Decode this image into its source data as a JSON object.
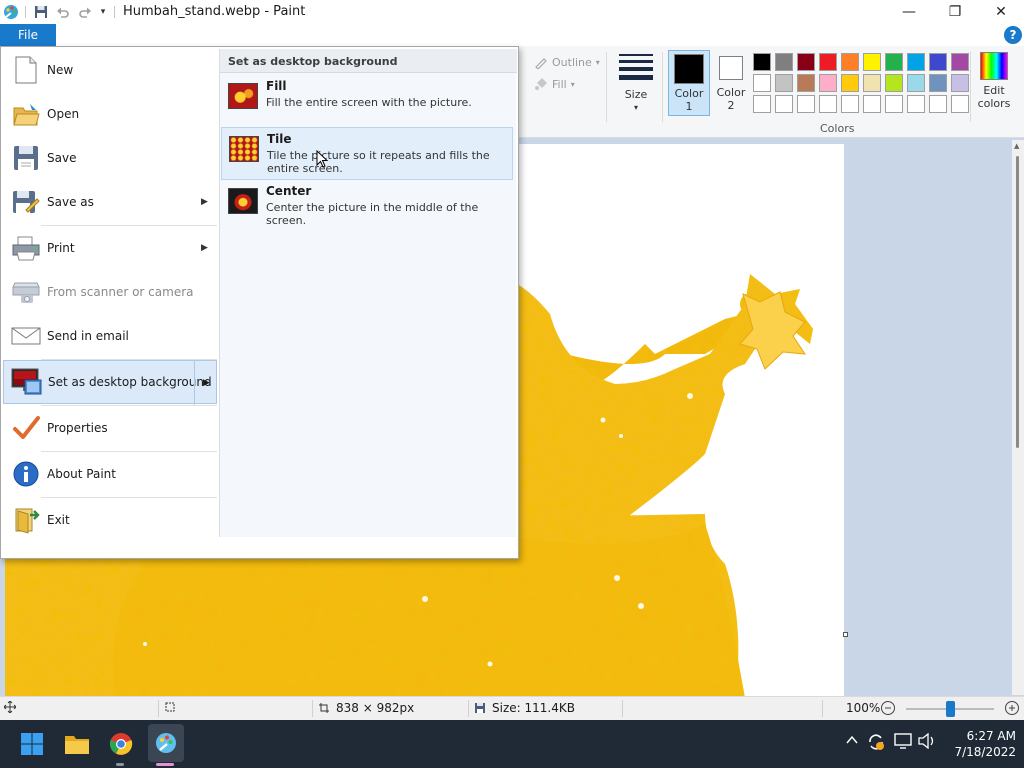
{
  "window": {
    "title": "Humbah_stand.webp - Paint",
    "quick_access_dropdown": "▾",
    "minimize": "—",
    "maximize": "❐",
    "close": "✕"
  },
  "ribbon": {
    "file_tab": "File",
    "help": "?",
    "outline_label": "Outline",
    "fill_label": "Fill",
    "size_label": "Size",
    "color1_label_a": "Color",
    "color1_label_b": "1",
    "color2_label_a": "Color",
    "color2_label_b": "2",
    "colors_group_label": "Colors",
    "edit_colors_a": "Edit",
    "edit_colors_b": "colors",
    "color1_value": "#000000",
    "color2_value": "#ffffff",
    "palette_row1": [
      "#000000",
      "#7f7f7f",
      "#880015",
      "#ed1c24",
      "#ff7f27",
      "#fff200",
      "#22b14c",
      "#00a2e8",
      "#3f48cc",
      "#a349a4"
    ],
    "palette_row2": [
      "#ffffff",
      "#c3c3c3",
      "#b97a57",
      "#ffaec9",
      "#ffc90e",
      "#efe4b0",
      "#b5e61d",
      "#99d9ea",
      "#7092be",
      "#c8bfe7"
    ],
    "palette_row3": [
      "#ffffff",
      "#ffffff",
      "#ffffff",
      "#ffffff",
      "#ffffff",
      "#ffffff",
      "#ffffff",
      "#ffffff",
      "#ffffff",
      "#ffffff"
    ]
  },
  "file_menu": {
    "items": [
      {
        "label": "New",
        "icon": "new-document-icon"
      },
      {
        "label": "Open",
        "icon": "open-folder-icon"
      },
      {
        "label": "Save",
        "icon": "save-icon"
      },
      {
        "label": "Save as",
        "icon": "save-as-icon"
      },
      {
        "label": "Print",
        "icon": "printer-icon"
      },
      {
        "label": "From scanner or camera",
        "icon": "scanner-icon"
      },
      {
        "label": "Send in email",
        "icon": "email-icon"
      },
      {
        "label": "Set as desktop background",
        "icon": "desktop-background-icon"
      },
      {
        "label": "Properties",
        "icon": "checkmark-icon"
      },
      {
        "label": "About Paint",
        "icon": "info-icon"
      },
      {
        "label": "Exit",
        "icon": "exit-icon"
      }
    ],
    "arrow": "▶"
  },
  "submenu": {
    "header": "Set as desktop background",
    "options": [
      {
        "title": "Fill",
        "desc": "Fill the entire screen with the picture."
      },
      {
        "title": "Tile",
        "desc": "Tile the picture so it repeats and fills the entire screen."
      },
      {
        "title": "Center",
        "desc": "Center the picture in the middle of the screen."
      }
    ]
  },
  "statusbar": {
    "dimensions": "838 × 982px",
    "size": "Size: 111.4KB",
    "zoom": "100%",
    "zoom_level": 0.5
  },
  "taskbar": {
    "time": "6:27 AM",
    "date": "7/18/2022"
  }
}
